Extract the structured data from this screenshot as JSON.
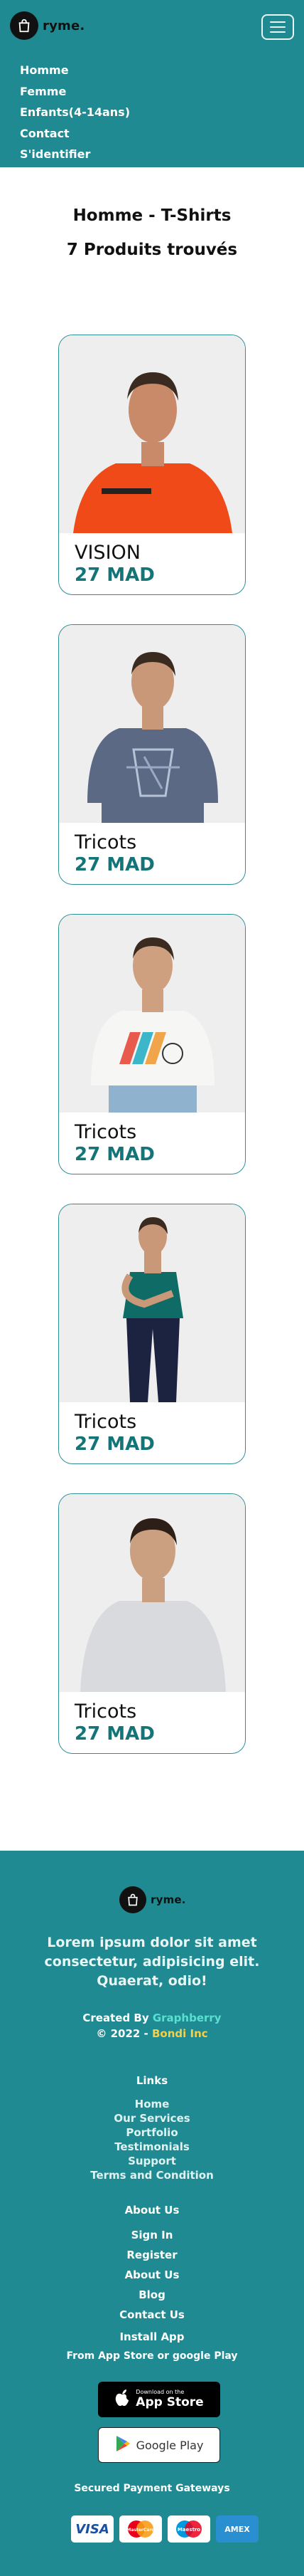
{
  "nav": {
    "brand": "ryme.",
    "menu": [
      "Homme",
      "Femme",
      "Enfants(4-14ans)",
      "Contact",
      "S'identifier"
    ]
  },
  "page": {
    "title": "Homme - T-Shirts",
    "count": "7 Produits trouvés"
  },
  "products": [
    {
      "name": "VISION",
      "price": "27 MAD",
      "image": "man-orange-tshirt"
    },
    {
      "name": "Tricots",
      "price": "27 MAD",
      "image": "man-blue-printed-tshirt"
    },
    {
      "name": "Tricots",
      "price": "27 MAD",
      "image": "man-white-printed-tshirt"
    },
    {
      "name": "Tricots",
      "price": "27 MAD",
      "image": "man-teal-tshirt"
    },
    {
      "name": "Tricots",
      "price": "27 MAD",
      "image": "man-grey-tshirt"
    }
  ],
  "footer": {
    "brand": "ryme.",
    "tagline": "Lorem ipsum dolor sit amet consectetur, adipisicing elit. Quaerat, odio!",
    "created_prefix": "Created By ",
    "created_by": "Graphberry",
    "copyright_prefix": "© 2022 - ",
    "company": "Bondi Inc",
    "links_title": "Links",
    "links": [
      "Home",
      "Our Services",
      "Portfolio",
      "Testimonials",
      "Support",
      "Terms and Condition"
    ],
    "about_title": "About Us",
    "about_links": [
      "Sign In",
      "Register",
      "About Us",
      "Blog",
      "Contact Us"
    ],
    "install_title": "Install App",
    "install_sub": "From App Store or google Play",
    "appstore_small": "Download on the",
    "appstore_big": "App Store",
    "googleplay": "Google Play",
    "payments_title": "Secured Payment Gateways",
    "payments": [
      {
        "name": "VISA",
        "color": "#1a4fa3"
      },
      {
        "name": "MasterCard",
        "color": "#e02b2b"
      },
      {
        "name": "Maestro",
        "color": "#1d6fb8"
      },
      {
        "name": "AMEX",
        "color": "#2a8fd1"
      }
    ]
  },
  "colors": {
    "primary": "#1f8a91",
    "price": "#137578",
    "accent_teal": "#59e0d1",
    "accent_yellow": "#f2d04a"
  }
}
